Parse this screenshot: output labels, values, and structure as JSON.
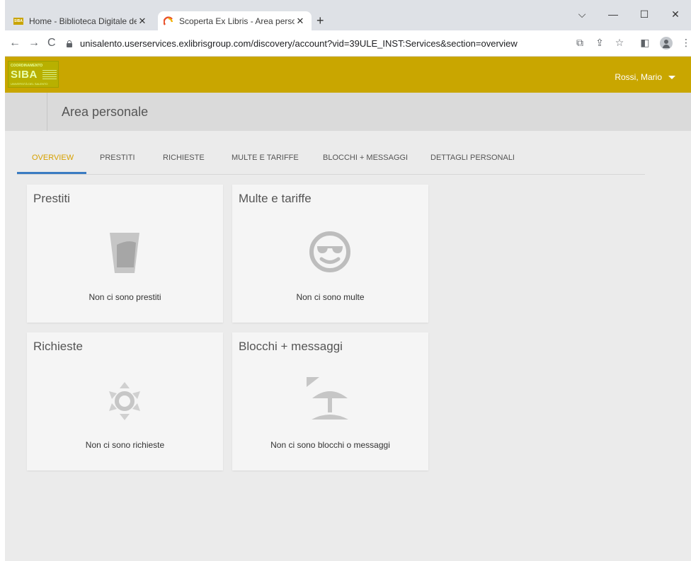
{
  "browser": {
    "tabs": [
      {
        "title": "Home - Biblioteca Digitale dell'U",
        "favicon": "siba-favicon",
        "favicon_text": "SIBA",
        "active": false
      },
      {
        "title": "Scoperta Ex Libris - Area persona",
        "favicon": "exlibris-favicon",
        "active": true
      }
    ],
    "tab_close_glyph": "✕",
    "new_tab_glyph": "+",
    "window_controls": {
      "dropdown": "⌵",
      "minimize": "—",
      "maximize": "☐",
      "close": "✕"
    },
    "nav": {
      "back": "←",
      "forward": "→",
      "reload": "C"
    },
    "url": "unisalento.userservices.exlibrisgroup.com/discovery/account?vid=39ULE_INST:Services&section=overview",
    "toolbar_icons": {
      "translate": "⧉",
      "share": "⇪",
      "bookmark": "☆",
      "sidepanel": "◧",
      "menu": "⋮"
    }
  },
  "header": {
    "logo": {
      "top": "COORDINAMENTO",
      "main": "SIBA",
      "sub": "UNIVERSITÀ DEL SALENTO"
    },
    "user_name": "Rossi, Mario",
    "accent_color": "#c9a600"
  },
  "page": {
    "title": "Area personale"
  },
  "nav_tabs": [
    {
      "label": "OVERVIEW",
      "active": true
    },
    {
      "label": "PRESTITI"
    },
    {
      "label": "RICHIESTE"
    },
    {
      "label": "MULTE E TARIFFE"
    },
    {
      "label": "BLOCCHI + MESSAGGI"
    },
    {
      "label": "DETTAGLI PERSONALI"
    }
  ],
  "cards": [
    {
      "title": "Prestiti",
      "message": "Non ci sono prestiti",
      "icon": "glass-icon"
    },
    {
      "title": "Multe e tariffe",
      "message": "Non ci sono multe",
      "icon": "sunglasses-smiley-icon"
    },
    {
      "title": "Richieste",
      "message": "Non ci sono richieste",
      "icon": "sun-icon"
    },
    {
      "title": "Blocchi + messaggi",
      "message": "Non ci sono blocchi o messaggi",
      "icon": "beach-umbrella-icon"
    }
  ]
}
